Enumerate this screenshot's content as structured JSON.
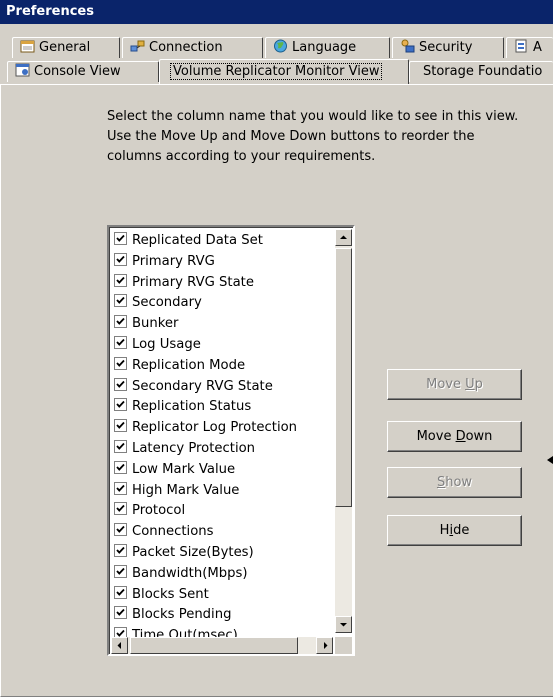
{
  "window": {
    "title": "Preferences"
  },
  "tabs_row1": [
    {
      "label": "General",
      "icon": "calendar-icon"
    },
    {
      "label": "Connection",
      "icon": "connection-icon"
    },
    {
      "label": "Language",
      "icon": "globe-icon"
    },
    {
      "label": "Security",
      "icon": "security-icon"
    },
    {
      "label": "A",
      "icon": "advanced-icon"
    }
  ],
  "tabs_row2": [
    {
      "label": "Console View",
      "icon": "console-icon"
    },
    {
      "label": "Volume Replicator Monitor View",
      "active": true
    },
    {
      "label": "Storage Foundatio"
    }
  ],
  "instructions": "Select the column name that you would like to see in this view. Use the Move Up and Move Down buttons to reorder the columns according to your requirements.",
  "columns": [
    {
      "label": "Replicated Data Set",
      "checked": true
    },
    {
      "label": "Primary RVG",
      "checked": true
    },
    {
      "label": "Primary RVG State",
      "checked": true
    },
    {
      "label": "Secondary",
      "checked": true
    },
    {
      "label": "Bunker",
      "checked": true
    },
    {
      "label": "Log Usage",
      "checked": true
    },
    {
      "label": "Replication Mode",
      "checked": true
    },
    {
      "label": "Secondary RVG State",
      "checked": true
    },
    {
      "label": "Replication Status",
      "checked": true
    },
    {
      "label": "Replicator Log Protection",
      "checked": true
    },
    {
      "label": "Latency Protection",
      "checked": true
    },
    {
      "label": "Low Mark Value",
      "checked": true
    },
    {
      "label": "High Mark Value",
      "checked": true
    },
    {
      "label": "Protocol",
      "checked": true
    },
    {
      "label": "Connections",
      "checked": true
    },
    {
      "label": "Packet Size(Bytes)",
      "checked": true
    },
    {
      "label": "Bandwidth(Mbps)",
      "checked": true
    },
    {
      "label": "Blocks Sent",
      "checked": true
    },
    {
      "label": "Blocks Pending",
      "checked": true
    },
    {
      "label": "Time Out(msec)",
      "checked": true
    }
  ],
  "buttons": {
    "move_up": {
      "pre": "Move ",
      "key": "U",
      "post": "p",
      "enabled": false
    },
    "move_down": {
      "pre": "Move ",
      "key": "D",
      "post": "own",
      "enabled": true
    },
    "show": {
      "pre": "",
      "key": "S",
      "post": "how",
      "enabled": false
    },
    "hide": {
      "pre": "H",
      "key": "i",
      "post": "de",
      "enabled": true
    }
  },
  "colors": {
    "titlebar": "#0a246a",
    "face": "#d4d0c8",
    "disabled_text": "#808080"
  }
}
